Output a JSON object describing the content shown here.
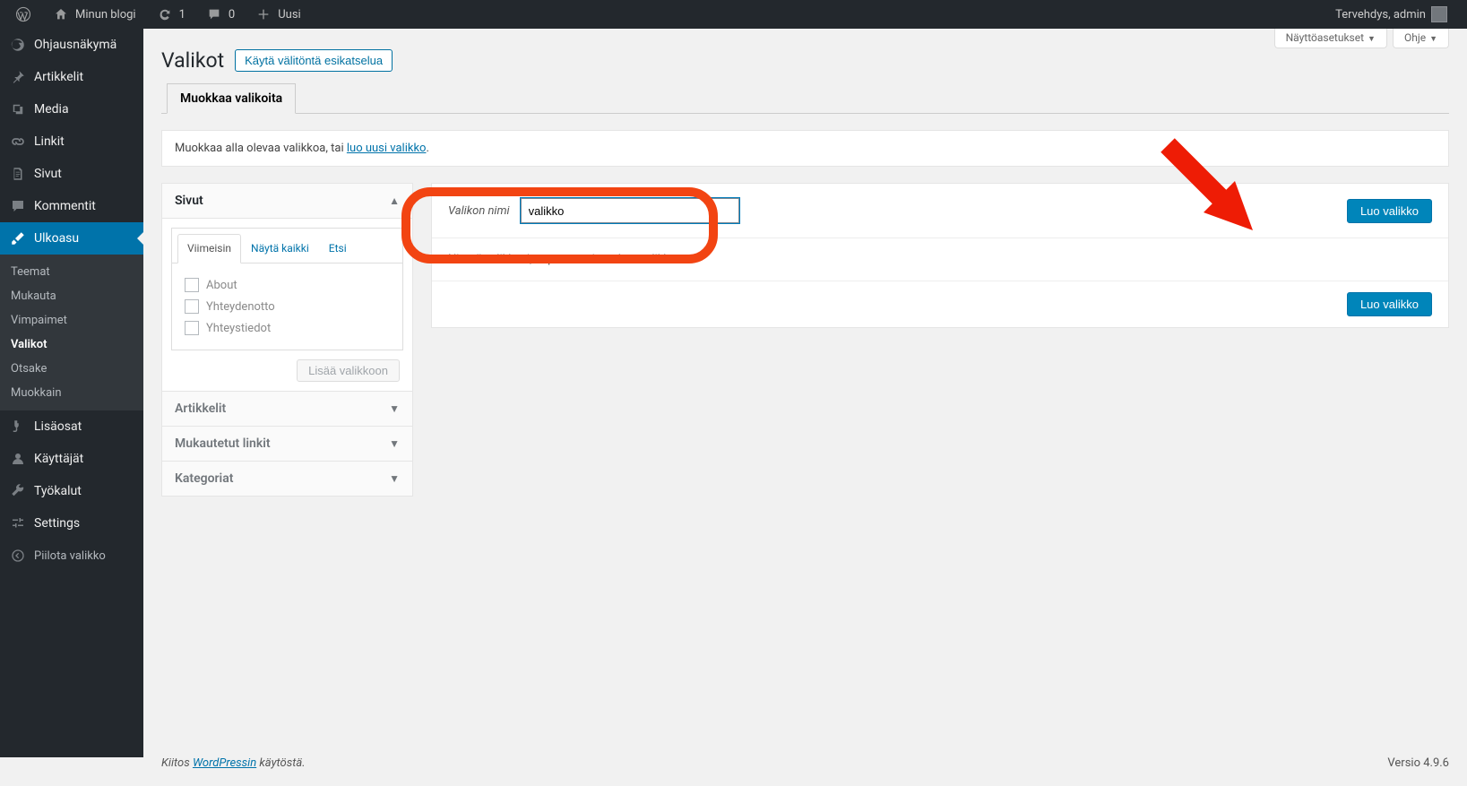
{
  "adminbar": {
    "site_name": "Minun blogi",
    "refresh_count": "1",
    "comment_count": "0",
    "new_label": "Uusi",
    "greeting": "Tervehdys, admin"
  },
  "sidebar": {
    "items": [
      {
        "label": "Ohjausnäkymä"
      },
      {
        "label": "Artikkelit"
      },
      {
        "label": "Media"
      },
      {
        "label": "Linkit"
      },
      {
        "label": "Sivut"
      },
      {
        "label": "Kommentit"
      },
      {
        "label": "Ulkoasu"
      },
      {
        "label": "Lisäosat"
      },
      {
        "label": "Käyttäjät"
      },
      {
        "label": "Työkalut"
      },
      {
        "label": "Settings"
      }
    ],
    "submenu": [
      {
        "label": "Teemat"
      },
      {
        "label": "Mukauta"
      },
      {
        "label": "Vimpaimet"
      },
      {
        "label": "Valikot"
      },
      {
        "label": "Otsake"
      },
      {
        "label": "Muokkain"
      }
    ],
    "collapse": "Piilota valikko"
  },
  "screen_meta": {
    "options": "Näyttöasetukset",
    "help": "Ohje"
  },
  "page": {
    "title": "Valikot",
    "action": "Käytä välitöntä esikatselua",
    "tab": "Muokkaa valikoita",
    "manage_prefix": "Muokkaa alla olevaa valikkoa, tai ",
    "manage_link": "luo uusi valikko",
    "manage_suffix": "."
  },
  "accord": {
    "pages": {
      "title": "Sivut",
      "tab_recent": "Viimeisin",
      "tab_all": "Näytä kaikki",
      "tab_search": "Etsi",
      "items": [
        "About",
        "Yhteydenotto",
        "Yhteystiedot"
      ],
      "add": "Lisää valikkoon"
    },
    "posts": "Artikkelit",
    "custom": "Mukautetut linkit",
    "cats": "Kategoriat"
  },
  "editor": {
    "name_label": "Valikon nimi",
    "name_value": "valikko",
    "create_btn": "Luo valikko",
    "body_text": "Nimeä valikkosi, napsauta sitten Luo valikko."
  },
  "footer": {
    "thanks_prefix": "Kiitos ",
    "thanks_link": "WordPressin",
    "thanks_suffix": " käytöstä.",
    "version": "Versio 4.9.6"
  }
}
